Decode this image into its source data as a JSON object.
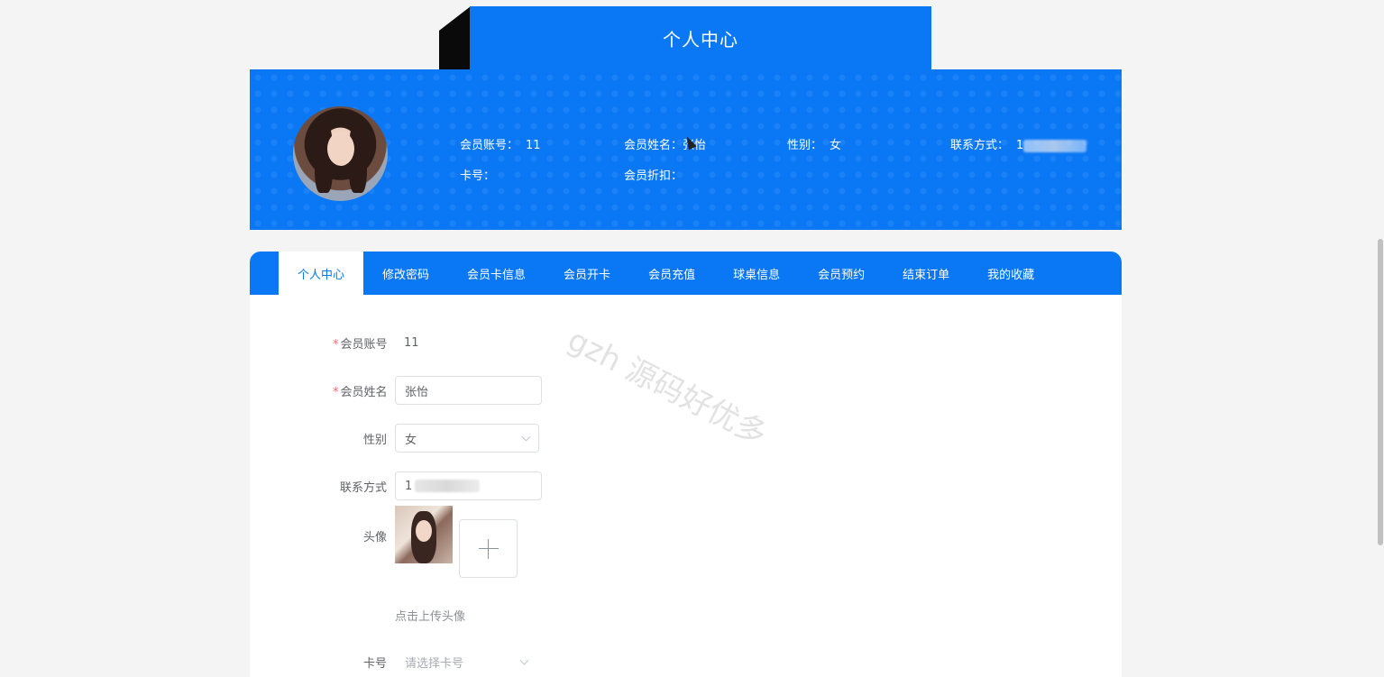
{
  "page": {
    "title": "个人中心",
    "watermark": "gzh 源码好优多"
  },
  "profile": {
    "account_label": "会员账号：",
    "account_value": "11",
    "name_label": "会员姓名：",
    "name_value": "张怡",
    "gender_label": "性别：",
    "gender_value": "女",
    "phone_label": "联系方式：",
    "phone_value": "1",
    "card_label": "卡号：",
    "card_value": "",
    "discount_label": "会员折扣：",
    "discount_value": ""
  },
  "tabs": [
    {
      "label": "个人中心",
      "active": true
    },
    {
      "label": "修改密码"
    },
    {
      "label": "会员卡信息"
    },
    {
      "label": "会员开卡"
    },
    {
      "label": "会员充值"
    },
    {
      "label": "球桌信息"
    },
    {
      "label": "会员预约"
    },
    {
      "label": "结束订单"
    },
    {
      "label": "我的收藏"
    }
  ],
  "form": {
    "account": {
      "label": "会员账号",
      "value": "11"
    },
    "name": {
      "label": "会员姓名",
      "value": "张怡"
    },
    "gender": {
      "label": "性别",
      "value": "女"
    },
    "phone": {
      "label": "联系方式",
      "value": "1"
    },
    "avatar": {
      "label": "头像",
      "tip": "点击上传头像"
    },
    "card": {
      "label": "卡号",
      "placeholder": "请选择卡号"
    }
  },
  "colors": {
    "primary": "#0a77f5",
    "required": "#f56c6c"
  }
}
